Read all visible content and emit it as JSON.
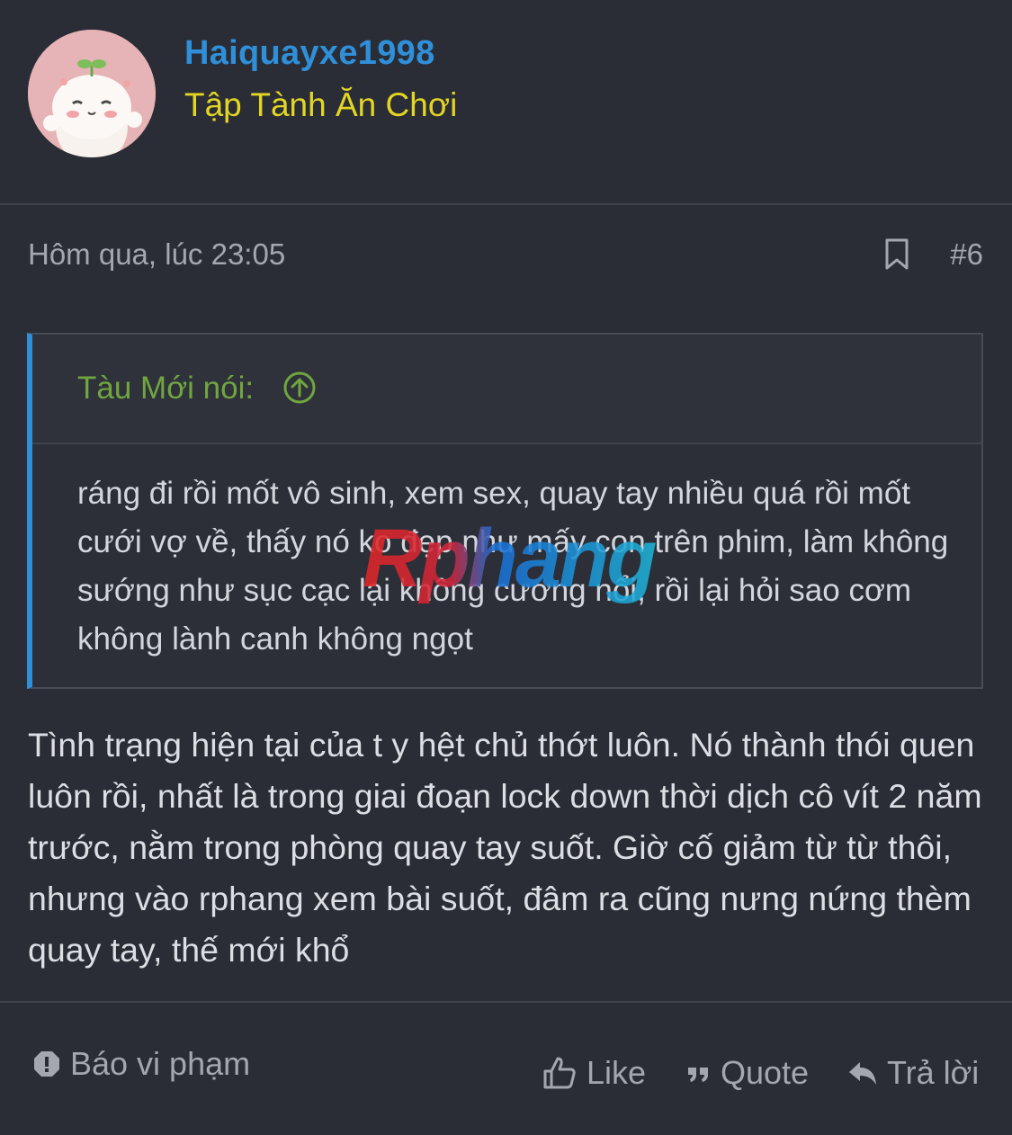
{
  "user": {
    "username": "Haiquayxe1998",
    "title": "Tập Tành Ăn Chơi"
  },
  "post": {
    "timestamp": "Hôm qua, lúc 23:05",
    "number": "#6",
    "quote": {
      "author": "Tàu Mới nói:",
      "text": "ráng đi rồi mốt vô sinh, xem sex, quay tay nhiều quá rồi mốt cưới vợ về, thấy nó ko đẹp như mấy con trên phim, làm không sướng như sục cạc lại không cương nổi, rồi lại hỏi sao cơm không lành canh không ngọt"
    },
    "body": "Tình trạng hiện tại của t y hệt chủ thớt luôn. Nó thành thói quen luôn rồi, nhất là trong giai đoạn lock down thời dịch cô vít 2 năm trước, nằm trong phòng quay tay suốt. Giờ cố giảm từ từ thôi, nhưng vào rphang xem bài suốt, đâm ra cũng nưng nứng thèm quay tay, thế mới khổ"
  },
  "watermark": {
    "text": "Rphang"
  },
  "actions": {
    "report": "Báo vi phạm",
    "like": "Like",
    "quote": "Quote",
    "reply": "Trả lời"
  },
  "colors": {
    "background": "#2a2d35",
    "username": "#2f8fd8",
    "user_title": "#e3d524",
    "quote_author": "#70a640",
    "quote_border": "#2f8fd8",
    "muted_text": "#a3a7b0"
  }
}
